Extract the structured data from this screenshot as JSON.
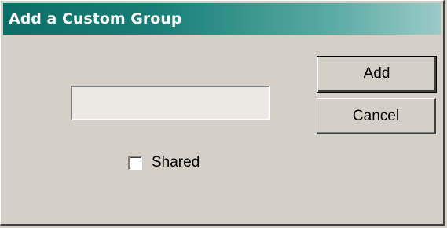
{
  "dialog": {
    "title": "Add a Custom Group",
    "input": {
      "value": "",
      "placeholder": ""
    },
    "shared_checkbox": {
      "label": "Shared",
      "checked": false
    },
    "buttons": {
      "add_label": "Add",
      "cancel_label": "Cancel"
    }
  },
  "colors": {
    "face": "#d4d0c8",
    "title_gradient_start": "#0a6e66",
    "title_gradient_end": "#9ccbc6",
    "title_text": "#ffffff"
  }
}
